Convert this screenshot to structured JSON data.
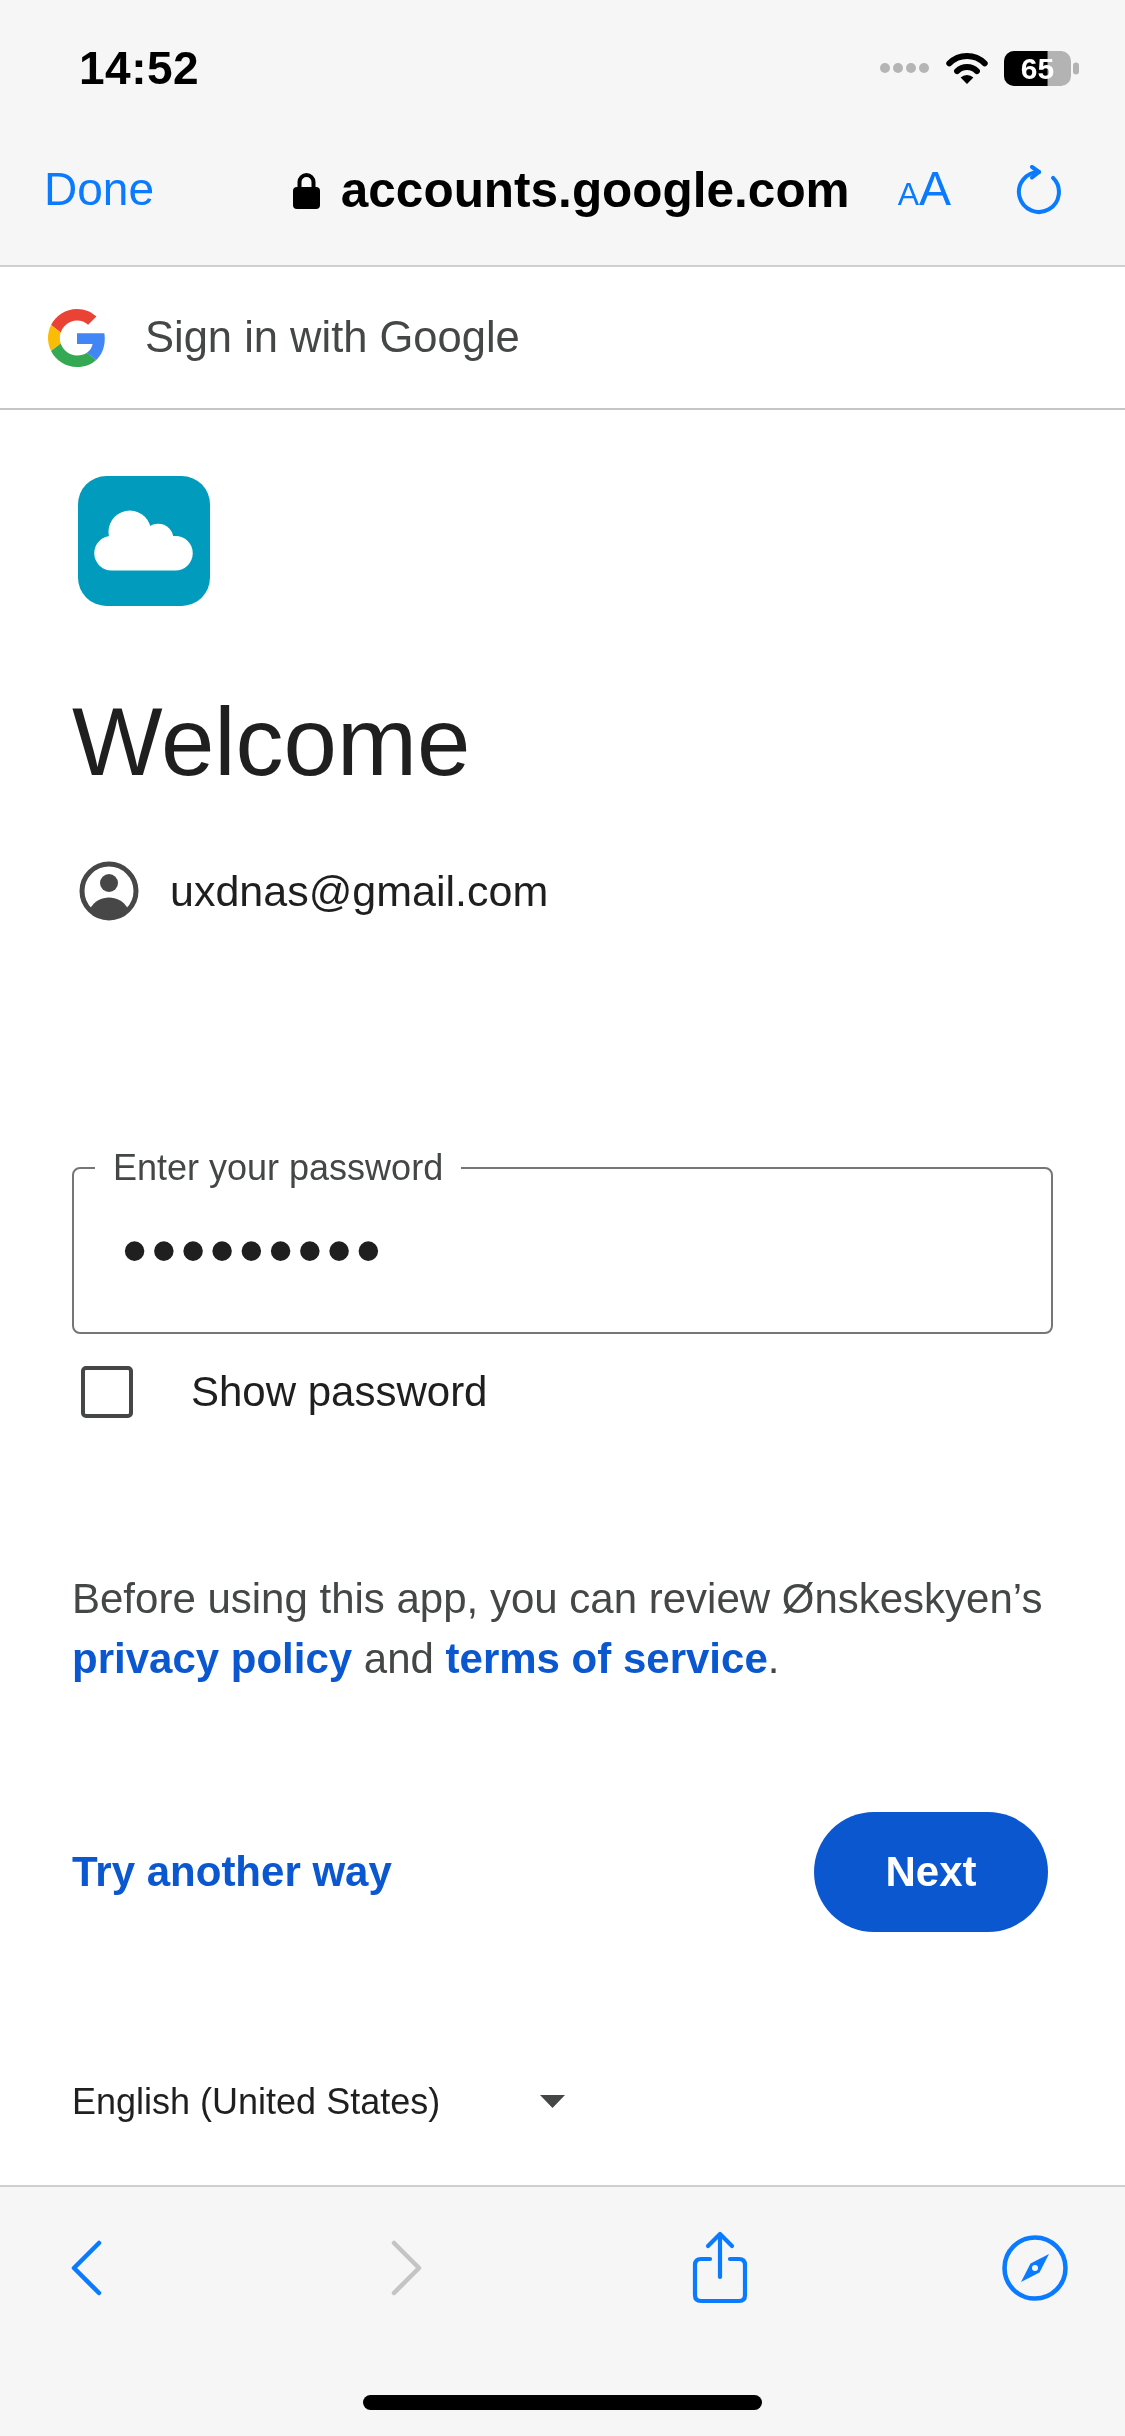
{
  "status_bar": {
    "time": "14:52",
    "battery": "65"
  },
  "browser_bar": {
    "done": "Done",
    "url": "accounts.google.com",
    "text_size": {
      "small": "A",
      "large": "A"
    }
  },
  "site_header": {
    "title": "Sign in with Google"
  },
  "welcome": {
    "title": "Welcome",
    "email": "uxdnas@gmail.com"
  },
  "password_field": {
    "label": "Enter your password",
    "value": "•••••••••"
  },
  "show_password": {
    "label": "Show password",
    "checked": false
  },
  "notice": [
    {
      "kind": "text",
      "text": "Before using this app, you can review Ønskeskyen’s "
    },
    {
      "kind": "link",
      "text": "privacy policy"
    },
    {
      "kind": "text",
      "text": " and "
    },
    {
      "kind": "link",
      "text": "terms of service"
    },
    {
      "kind": "text",
      "text": "."
    }
  ],
  "actions": {
    "secondary": "Try another way",
    "primary": "Next"
  },
  "language": {
    "value": "English (United States)"
  },
  "toolbar": [
    {
      "kind": "back",
      "disabled": false
    },
    {
      "kind": "forward",
      "disabled": true
    },
    {
      "kind": "share",
      "disabled": false
    },
    {
      "kind": "compass",
      "disabled": false
    }
  ]
}
